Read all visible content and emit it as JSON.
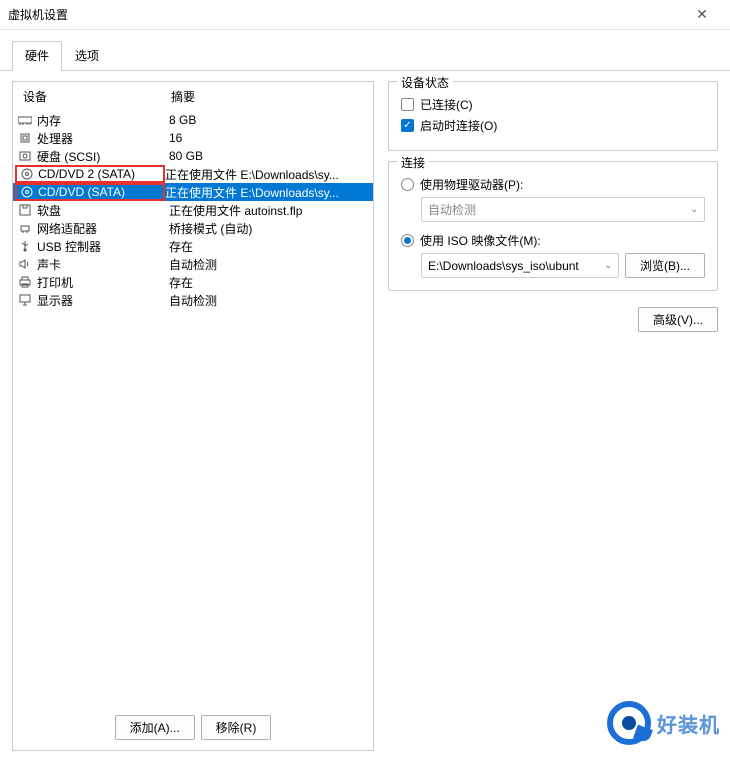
{
  "title": "虚拟机设置",
  "tabs": {
    "hardware": "硬件",
    "options": "选项"
  },
  "hw_header": {
    "device": "设备",
    "summary": "摘要"
  },
  "hw": [
    {
      "icon": "memory-icon",
      "dev": "内存",
      "sum": "8 GB"
    },
    {
      "icon": "cpu-icon",
      "dev": "处理器",
      "sum": "16"
    },
    {
      "icon": "disk-icon",
      "dev": "硬盘 (SCSI)",
      "sum": "80 GB"
    },
    {
      "icon": "disc-icon",
      "dev": "CD/DVD 2 (SATA)",
      "sum": "正在使用文件 E:\\Downloads\\sy..."
    },
    {
      "icon": "disc-icon",
      "dev": "CD/DVD (SATA)",
      "sum": "正在使用文件 E:\\Downloads\\sy..."
    },
    {
      "icon": "floppy-icon",
      "dev": "软盘",
      "sum": "正在使用文件 autoinst.flp"
    },
    {
      "icon": "net-icon",
      "dev": "网络适配器",
      "sum": "桥接模式 (自动)"
    },
    {
      "icon": "usb-icon",
      "dev": "USB 控制器",
      "sum": "存在"
    },
    {
      "icon": "sound-icon",
      "dev": "声卡",
      "sum": "自动检测"
    },
    {
      "icon": "printer-icon",
      "dev": "打印机",
      "sum": "存在"
    },
    {
      "icon": "display-icon",
      "dev": "显示器",
      "sum": "自动检测"
    }
  ],
  "buttons": {
    "add": "添加(A)...",
    "remove": "移除(R)"
  },
  "status_group": {
    "title": "设备状态",
    "connected": "已连接(C)",
    "connect_at_power": "启动时连接(O)"
  },
  "conn_group": {
    "title": "连接",
    "physical": "使用物理驱动器(P):",
    "auto_detect": "自动检测",
    "iso": "使用 ISO 映像文件(M):",
    "iso_path": "E:\\Downloads\\sys_iso\\ubunt",
    "browse": "浏览(B)..."
  },
  "advanced": "高级(V)...",
  "watermark": "好装机",
  "selected_index": 4,
  "highlight_indices": [
    3,
    4
  ]
}
